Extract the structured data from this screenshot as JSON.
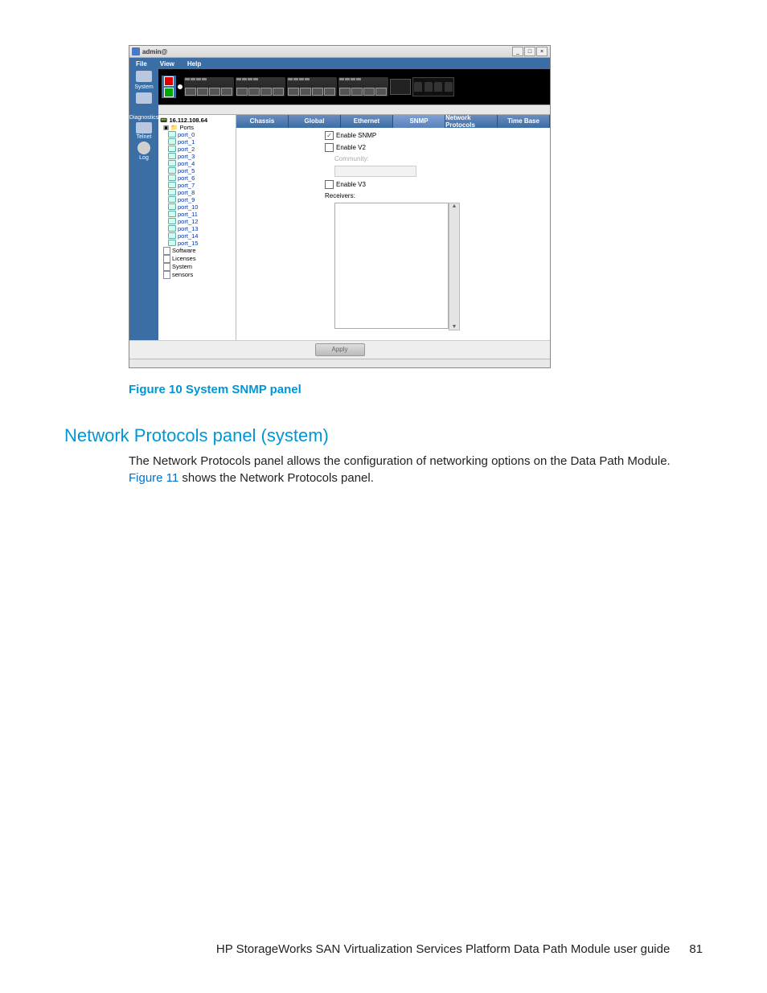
{
  "window": {
    "title": "admin@",
    "menu": [
      "File",
      "View",
      "Help"
    ],
    "win_controls": {
      "min": "_",
      "max": "□",
      "close": "×"
    }
  },
  "sidebar": {
    "items": [
      "System",
      "Diagnostics",
      "Telnet",
      "Log"
    ]
  },
  "tree": {
    "root": "16.112.108.64",
    "folder": "Ports",
    "ports": [
      "port_0",
      "port_1",
      "port_2",
      "port_3",
      "port_4",
      "port_5",
      "port_6",
      "port_7",
      "port_8",
      "port_9",
      "port_10",
      "port_11",
      "port_12",
      "port_13",
      "port_14",
      "port_15"
    ],
    "extras": [
      "Software",
      "Licenses",
      "System",
      "sensors"
    ]
  },
  "tabs": [
    "Chassis",
    "Global",
    "Ethernet",
    "SNMP",
    "Network Protocols",
    "Time Base"
  ],
  "panel": {
    "enable_snmp": "Enable SNMP",
    "enable_v2": "Enable V2",
    "community": "Community:",
    "enable_v3": "Enable V3",
    "receivers": "Receivers:",
    "apply": "Apply"
  },
  "caption": "Figure 10 System SNMP panel",
  "section_heading": "Network Protocols panel (system)",
  "para1": "The Network Protocols panel allows the configuration of networking options on the Data Path Module.",
  "para2a": "Figure 11",
  "para2b": " shows the Network Protocols panel.",
  "footer": {
    "text": "HP StorageWorks SAN Virtualization Services Platform Data Path Module user guide",
    "page": "81"
  }
}
